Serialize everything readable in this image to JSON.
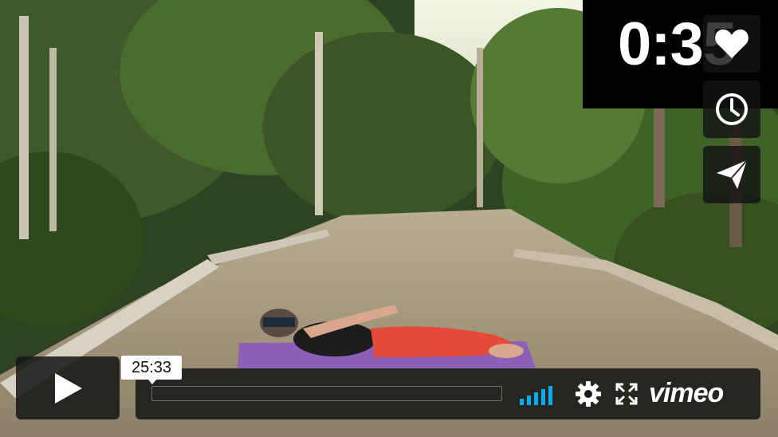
{
  "player": {
    "timer": "0:35",
    "duration": "25:33",
    "progress_fraction": 0.0,
    "brand": "vimeo",
    "accent_color": "#00adef"
  },
  "side_actions": [
    {
      "name": "like",
      "icon": "heart-icon"
    },
    {
      "name": "watch-later",
      "icon": "clock-icon"
    },
    {
      "name": "share",
      "icon": "paper-plane-icon"
    }
  ],
  "controls": {
    "play_icon": "play-icon",
    "volume_icon": "volume-bars-icon",
    "settings_icon": "gear-icon",
    "fullscreen_icon": "fullscreen-icon"
  }
}
